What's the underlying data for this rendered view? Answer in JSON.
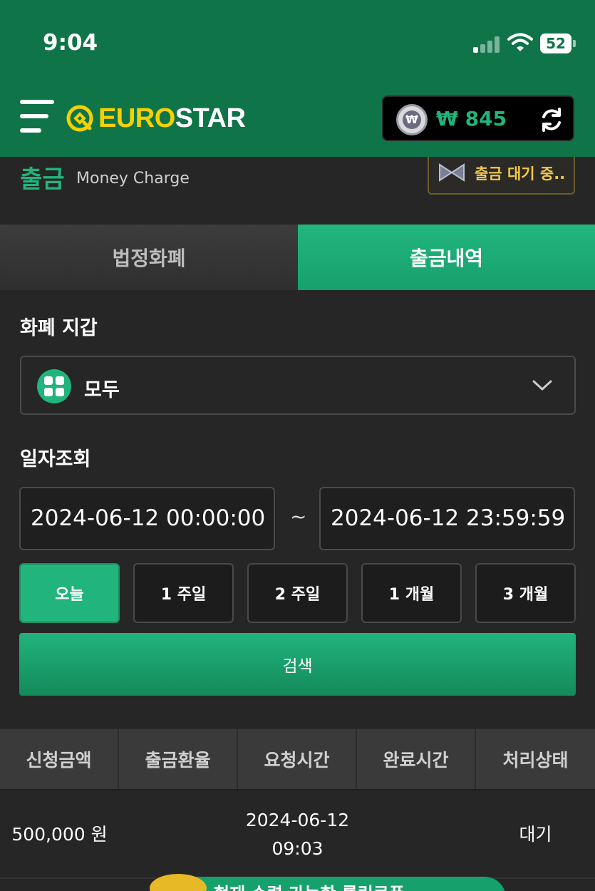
{
  "status_bar": {
    "time": "9:04",
    "battery": "52"
  },
  "header": {
    "logo_part1": "EURO",
    "logo_part2": "STAR",
    "currency_symbol": "₩",
    "balance": "₩ 845"
  },
  "page": {
    "title": "출금",
    "subtitle": "Money Charge",
    "pending_label": "출금 대기 중.."
  },
  "tabs": [
    {
      "label": "법정화폐",
      "active": false
    },
    {
      "label": "출금내역",
      "active": true
    }
  ],
  "form": {
    "wallet_label": "화폐 지갑",
    "wallet_value": "모두",
    "date_label": "일자조회",
    "date_from": "2024-06-12 00:00:00",
    "date_separator": "~",
    "date_to": "2024-06-12 23:59:59",
    "periods": [
      "오늘",
      "1 주일",
      "2 주일",
      "1 개월",
      "3 개월"
    ],
    "active_period": "오늘",
    "search_label": "검색"
  },
  "table": {
    "headers": [
      "신청금액",
      "출금환율",
      "요청시간",
      "완료시간",
      "처리상태"
    ],
    "rows": [
      {
        "amount": "500,000 원",
        "rate": "",
        "request_date": "2024-06-12",
        "request_time": "09:03",
        "complete_time": "",
        "status": "대기"
      }
    ]
  },
  "banner": {
    "text": "현재 수령 가능한 롤링쿠폰"
  },
  "colors": {
    "header_bg": "#0f7549",
    "accent": "#21b47c",
    "brand_yellow": "#f5d100",
    "pending_yellow": "#f2c94c",
    "page_bg": "#262626"
  }
}
